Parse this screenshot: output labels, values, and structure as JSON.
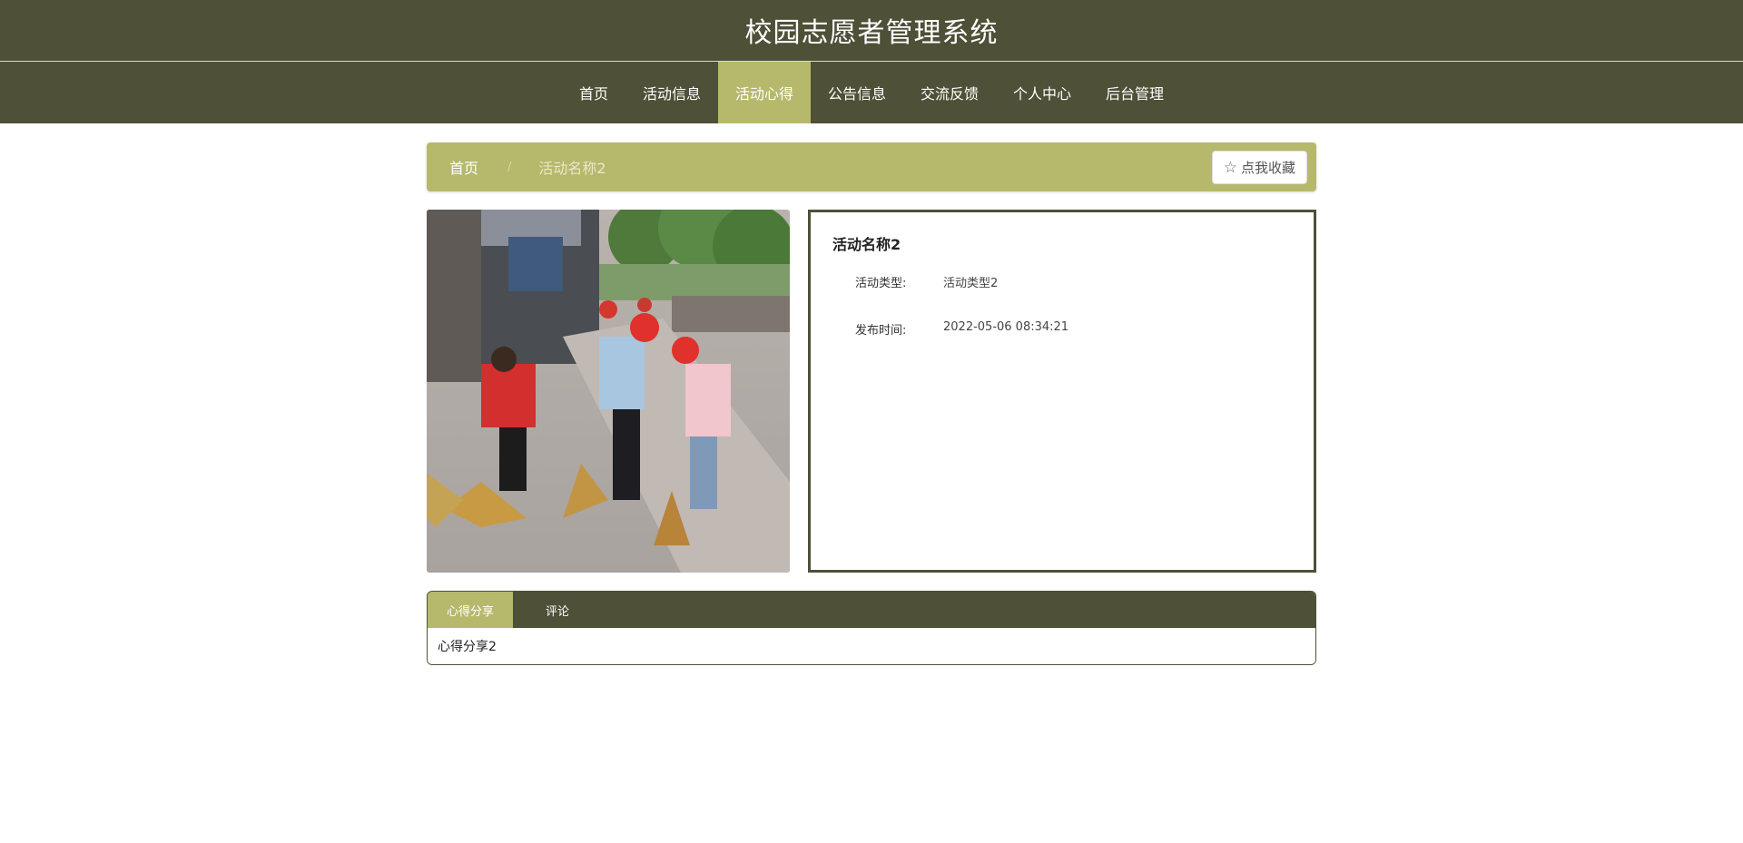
{
  "site": {
    "title": "校园志愿者管理系统"
  },
  "nav": {
    "items": [
      {
        "label": "首页"
      },
      {
        "label": "活动信息"
      },
      {
        "label": "活动心得"
      },
      {
        "label": "公告信息"
      },
      {
        "label": "交流反馈"
      },
      {
        "label": "个人中心"
      },
      {
        "label": "后台管理"
      }
    ],
    "active_index": 2
  },
  "breadcrumb": {
    "home": "首页",
    "separator": "/",
    "current": "活动名称2"
  },
  "favorite_button": {
    "icon": "star-outline-icon",
    "label": "点我收藏"
  },
  "photo": {
    "description_name": "activity-photo"
  },
  "detail": {
    "title": "活动名称2",
    "rows": [
      {
        "label": "活动类型:",
        "value": "活动类型2"
      },
      {
        "label": "发布时间:",
        "value": "2022-05-06 08:34:21"
      }
    ]
  },
  "tabs": {
    "items": [
      {
        "label": "心得分享"
      },
      {
        "label": "评论"
      }
    ],
    "active_index": 0,
    "content": "心得分享2"
  },
  "colors": {
    "primary_dark": "#4e5037",
    "accent": "#b6b96b"
  }
}
